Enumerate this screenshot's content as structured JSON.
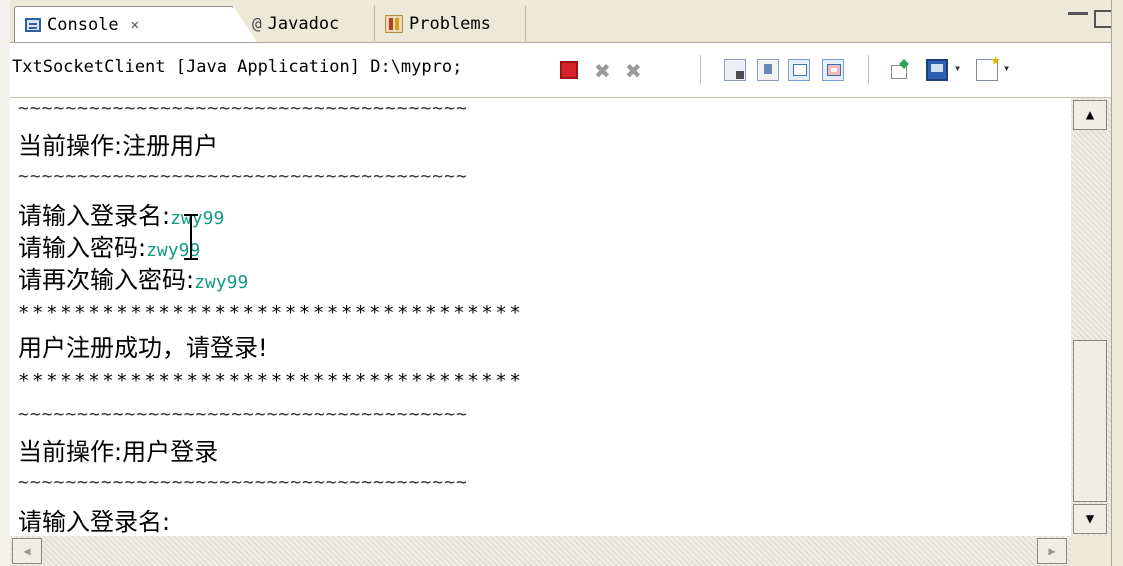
{
  "tabs": {
    "console": "Console",
    "javadoc": "Javadoc",
    "problems": "Problems"
  },
  "toolbar": {
    "process": "TxtSocketClient [Java Application] D:\\mypro;"
  },
  "console": {
    "tilde_separator": "~~~~~~~~~~~~~~~~~~~~~~~~~~~~~~~~~~~~~~",
    "star_separator": "************************************",
    "op_register": "当前操作:注册用户",
    "prompt_login": "请输入登录名:",
    "prompt_password": "请输入密码:",
    "prompt_password_again": "请再次输入密码:",
    "input_value": "zwy99",
    "register_success": "用户注册成功，请登录!",
    "op_login": "当前操作:用户登录"
  },
  "colors": {
    "input_text": "#0f9c83",
    "terminate": "#d6232a"
  },
  "icons": [
    "console-icon",
    "close-icon",
    "javadoc-icon",
    "problems-icon",
    "terminate-icon",
    "remove-launch-icon",
    "remove-all-launches-icon",
    "clear-console-icon",
    "scroll-lock-icon",
    "pin-console-icon",
    "show-stderr-icon",
    "open-console-icon",
    "display-selected-console-icon",
    "new-console-icon"
  ]
}
